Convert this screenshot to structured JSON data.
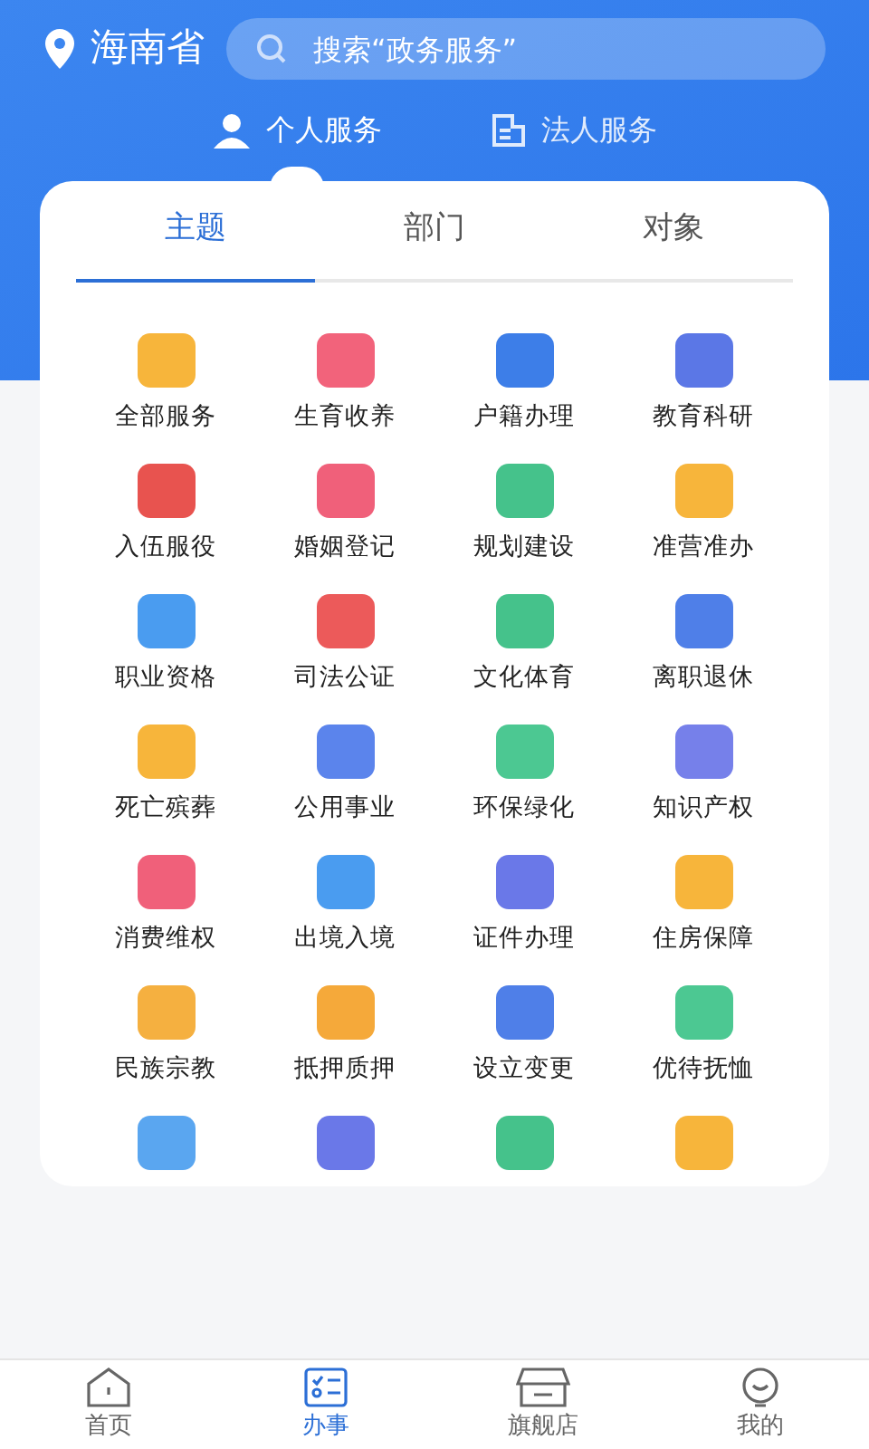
{
  "header": {
    "location": "海南省",
    "search": {
      "placeholder": "搜索“政务服务”"
    }
  },
  "service_tabs": [
    {
      "label": "个人服务",
      "kind": "person",
      "selected": true
    },
    {
      "label": "法人服务",
      "kind": "company",
      "selected": false
    }
  ],
  "category_tabs": [
    {
      "label": "主题",
      "selected": true
    },
    {
      "label": "部门",
      "selected": false
    },
    {
      "label": "对象",
      "selected": false
    }
  ],
  "services": [
    {
      "label": "全部服务",
      "color": "#f7b53b"
    },
    {
      "label": "生育收养",
      "color": "#f2637b"
    },
    {
      "label": "户籍办理",
      "color": "#3d7ee8"
    },
    {
      "label": "教育科研",
      "color": "#5b77e6"
    },
    {
      "label": "入伍服役",
      "color": "#e8534f"
    },
    {
      "label": "婚姻登记",
      "color": "#f0607a"
    },
    {
      "label": "规划建设",
      "color": "#45c28b"
    },
    {
      "label": "准营准办",
      "color": "#f7b53b"
    },
    {
      "label": "职业资格",
      "color": "#4a9cf0"
    },
    {
      "label": "司法公证",
      "color": "#ec5a5a"
    },
    {
      "label": "文化体育",
      "color": "#45c28b"
    },
    {
      "label": "离职退休",
      "color": "#4f7fe8"
    },
    {
      "label": "死亡殡葬",
      "color": "#f7b53b"
    },
    {
      "label": "公用事业",
      "color": "#5b84ec"
    },
    {
      "label": "环保绿化",
      "color": "#4cc892"
    },
    {
      "label": "知识产权",
      "color": "#7680ea"
    },
    {
      "label": "消费维权",
      "color": "#f0607a"
    },
    {
      "label": "出境入境",
      "color": "#4a9cf0"
    },
    {
      "label": "证件办理",
      "color": "#6a78e8"
    },
    {
      "label": "住房保障",
      "color": "#f7b53b"
    },
    {
      "label": "民族宗教",
      "color": "#f5b040"
    },
    {
      "label": "抵押质押",
      "color": "#f5a93a"
    },
    {
      "label": "设立变更",
      "color": "#4f7fe8"
    },
    {
      "label": "优待抚恤",
      "color": "#4cc892"
    },
    {
      "color": "#5aa6f0"
    },
    {
      "color": "#6a78e8"
    },
    {
      "color": "#45c28b"
    },
    {
      "color": "#f7b53b"
    }
  ],
  "bottom_nav": [
    {
      "label": "首页",
      "kind": "home",
      "selected": false
    },
    {
      "label": "办事",
      "kind": "tasks",
      "selected": true
    },
    {
      "label": "旗舰店",
      "kind": "store",
      "selected": false
    },
    {
      "label": "我的",
      "kind": "profile",
      "selected": false
    }
  ]
}
